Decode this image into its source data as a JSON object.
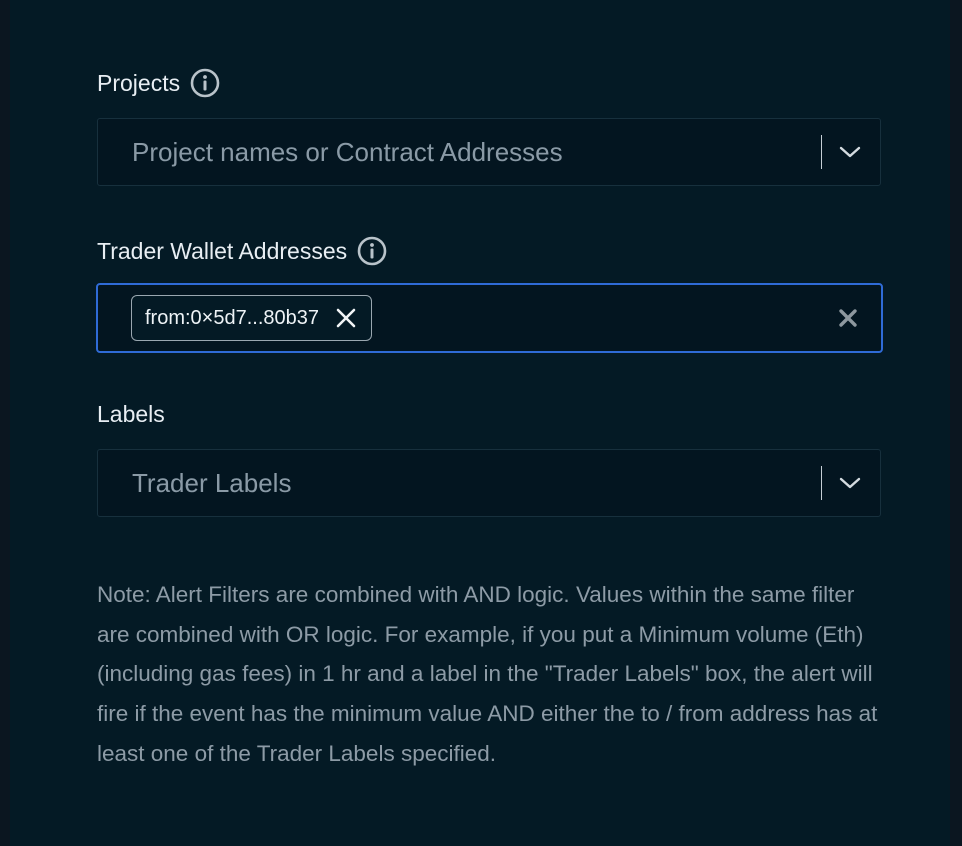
{
  "projects": {
    "label": "Projects",
    "info_icon": "info-icon",
    "placeholder": "Project names or Contract Addresses",
    "dropdown_icon": "chevron-down-icon"
  },
  "trader_wallets": {
    "label": "Trader Wallet Addresses",
    "info_icon": "info-icon",
    "chips": [
      {
        "text": "from:0×5d7...80b37",
        "remove_icon": "close-icon"
      }
    ],
    "clear_icon": "clear-all-icon"
  },
  "labels": {
    "label": "Labels",
    "placeholder": "Trader Labels",
    "dropdown_icon": "chevron-down-icon"
  },
  "note": "Note: Alert Filters are combined with AND logic. Values within the same filter are combined with OR logic. For example, if you put a Minimum volume (Eth) (including gas fees) in 1 hr and a label in the \"Trader Labels\" box, the alert will fire if the event has the minimum value AND either the to / from address has at least one of the Trader Labels specified.",
  "colors": {
    "panel_bg": "#041a25",
    "input_bg": "#031520",
    "focus_border": "#2f6bd6",
    "muted_text": "#8d9ba6",
    "label_text": "#e8eef3"
  }
}
